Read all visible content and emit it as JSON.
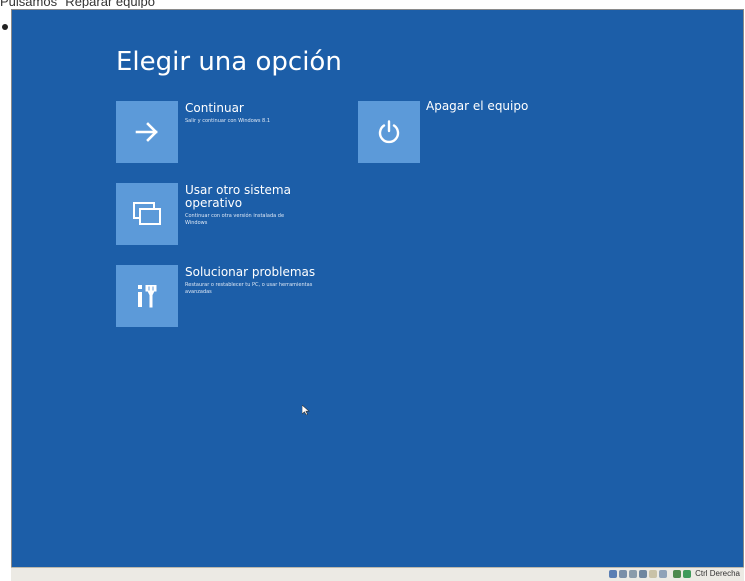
{
  "caption": "Pulsamos \"Reparar equipo\"",
  "screen": {
    "title": "Elegir una opción",
    "background_color": "#1c5ea8",
    "tile_color": "#5c9ad9",
    "options": [
      {
        "title": "Continuar",
        "description": "Salir y continuar con Windows 8.1",
        "icon": "arrow-right-icon"
      },
      {
        "title": "Usar otro sistema operativo",
        "description": "Continuar con otra versión instalada de Windows",
        "icon": "windows-stack-icon"
      },
      {
        "title": "Solucionar problemas",
        "description": "Restaurar o restablecer tu PC, o usar herramientas avanzadas",
        "icon": "tools-icon"
      },
      {
        "title": "Apagar el equipo",
        "description": "",
        "icon": "power-icon"
      }
    ]
  },
  "statusbar": {
    "host_key": "Ctrl Derecha",
    "icons": [
      "harddisk-icon",
      "optical-drive-icon",
      "usb-icon",
      "network-icon",
      "shared-folder-icon",
      "display-icon",
      "mouse-integration-icon",
      "host-key-indicator-icon"
    ]
  }
}
